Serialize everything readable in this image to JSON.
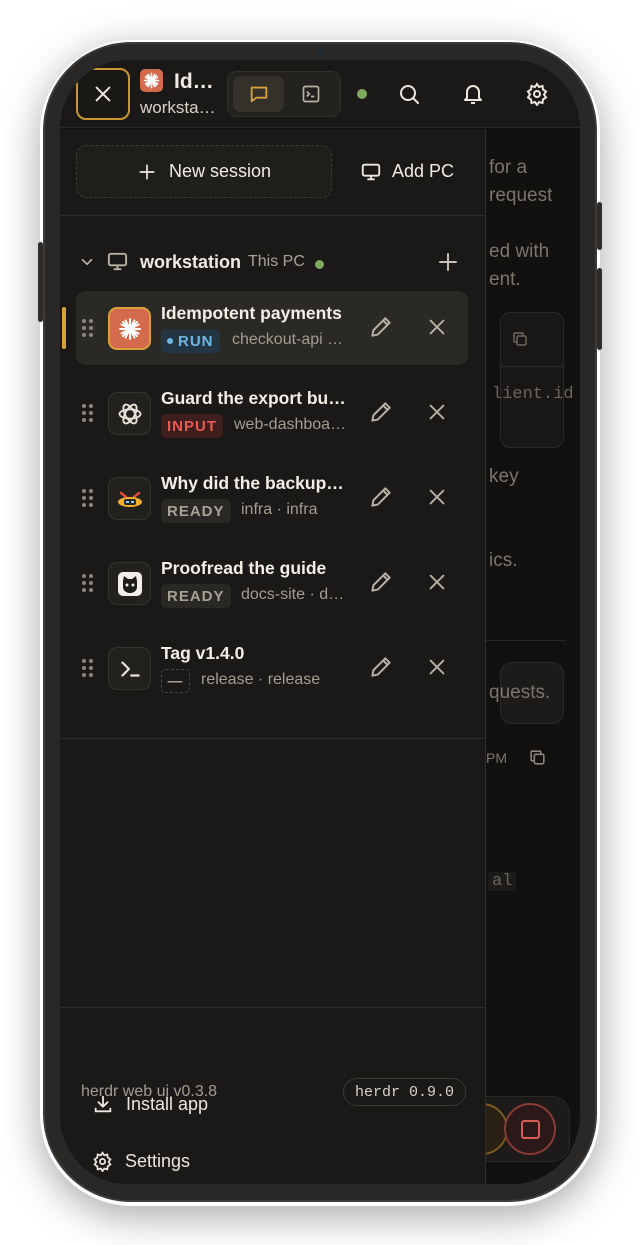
{
  "colors": {
    "accent": "#d9a13a",
    "online": "#7ea85b",
    "run": "#6fb7e0",
    "input": "#ea5a52",
    "drawer_bg": "#1b1917"
  },
  "topbar": {
    "close_icon": "close-icon",
    "title": "Id…",
    "subtitle": "workstation",
    "modes": [
      {
        "icon": "chat-icon",
        "active": true
      },
      {
        "icon": "terminal-icon",
        "active": false
      }
    ],
    "status": "online",
    "icons": [
      "search-icon",
      "bell-icon",
      "gear-icon"
    ]
  },
  "drawer": {
    "new_session_label": "New session",
    "add_pc_label": "Add PC",
    "machine": {
      "name": "workstation",
      "tag": "This PC",
      "status": "online"
    },
    "sessions": [
      {
        "title": "Idempotent payments",
        "status": "RUN",
        "meta": "checkout-api · checkout-api",
        "icon": "claude-icon",
        "active": true
      },
      {
        "title": "Guard the export button",
        "status": "INPUT",
        "meta": "web-dashboard · web-dashboard",
        "icon": "openai-icon",
        "active": false
      },
      {
        "title": "Why did the backup fail",
        "status": "READY",
        "meta": "infra · infra",
        "icon": "agent-icon",
        "active": false
      },
      {
        "title": "Proofread the guide",
        "status": "READY",
        "meta": "docs-site · docs-site",
        "icon": "cat-icon",
        "active": false
      },
      {
        "title": "Tag v1.4.0",
        "status": "—",
        "meta": "release · release",
        "icon": "terminal-icon",
        "active": false
      }
    ],
    "footer": {
      "install_label": "Install app",
      "settings_label": "Settings",
      "version_label": "herdr web ui v0.3.8",
      "server_version": "herdr 0.9.0"
    }
  },
  "background": {
    "lines": [
      "for a",
      "request",
      "ed with",
      "ent.",
      "lient.id",
      "key",
      "ics.",
      "quests.",
      "PM",
      "al"
    ]
  }
}
